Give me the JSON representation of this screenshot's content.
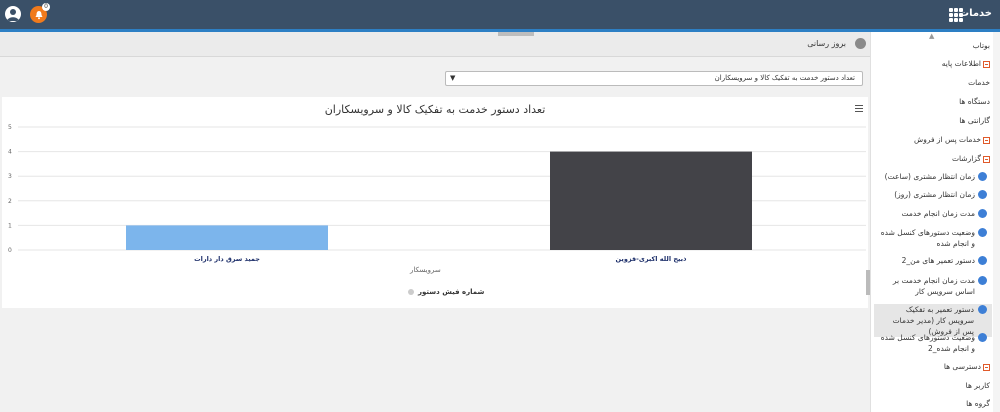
{
  "header": {
    "brand": "خدمات",
    "notification_count": "0"
  },
  "subbar": {
    "update_label": "بروز رسانی"
  },
  "filter": {
    "selected": "تعداد دستور خدمت به تفکیک کالا و سرویسکاران"
  },
  "chart_data": {
    "type": "bar",
    "title": "تعداد دستور خدمت به تفکیک کالا و سرویسکاران",
    "xlabel": "سرویسکار",
    "ylabel": "",
    "categories": [
      "جمید سرق دار دارات",
      "ذبیح الله اکبری-قزوین"
    ],
    "series": [
      {
        "name": "شماره فیش دستور",
        "values": [
          1,
          4
        ],
        "colors": [
          "#7cb5ec",
          "#434348"
        ]
      }
    ],
    "ylim": [
      0,
      5
    ],
    "yticks": [
      "0",
      "1",
      "2",
      "3",
      "4",
      "5"
    ],
    "grid": true,
    "legend": "bottom"
  },
  "sidebar": {
    "items": [
      {
        "label": "بوتاب",
        "type": "plain"
      },
      {
        "label": "اطلاعات پایه",
        "type": "section"
      },
      {
        "label": "خدمات",
        "type": "plain"
      },
      {
        "label": "دستگاه ها",
        "type": "plain"
      },
      {
        "label": "گارانتی ها",
        "type": "plain"
      },
      {
        "label": "خدمات پس از فروش",
        "type": "section"
      },
      {
        "label": "گزارشات",
        "type": "section"
      },
      {
        "label": "زمان انتظار مشتری (ساعت)",
        "type": "report"
      },
      {
        "label": "زمان انتظار مشتری (روز)",
        "type": "report"
      },
      {
        "label": "مدت زمان انجام خدمت",
        "type": "report"
      },
      {
        "label": "وضعیت دستورهای کنسل شده و انجام شده",
        "type": "report"
      },
      {
        "label": "دستور تعمیر های من_2",
        "type": "report"
      },
      {
        "label": "مدت زمان انجام خدمت بر اساس سرویس کار",
        "type": "report"
      },
      {
        "label": "دستور تعمیر به تفکیک سرویس کار (مدیر خدمات پس از فروش)",
        "type": "report"
      },
      {
        "label": "وضعیت دستورهای کنسل شده و انجام شده_2",
        "type": "report"
      },
      {
        "label": "دسترسی ها",
        "type": "section"
      },
      {
        "label": "کاربر ها",
        "type": "plain"
      },
      {
        "label": "گروه ها",
        "type": "plain"
      }
    ]
  }
}
